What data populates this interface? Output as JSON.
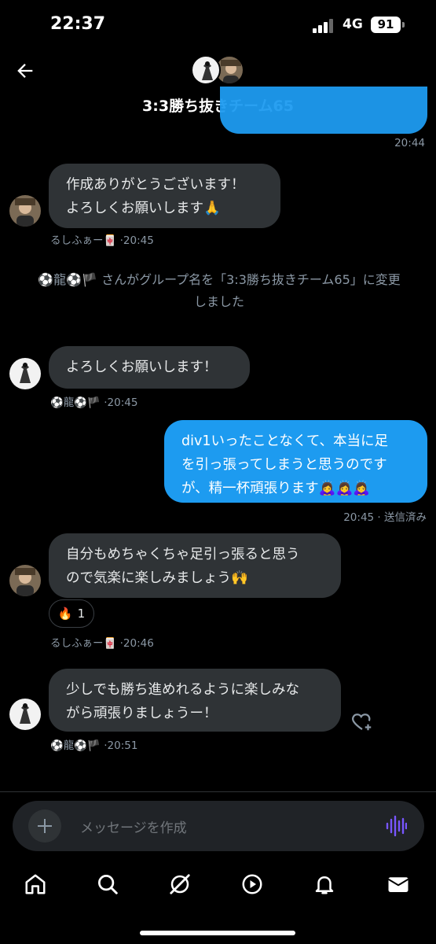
{
  "status": {
    "time": "22:37",
    "network": "4G",
    "battery": "91"
  },
  "header": {
    "title": "3:3勝ち抜きチーム65"
  },
  "messages": [
    {
      "time": "20:44"
    },
    {
      "lines": [
        "作成ありがとうございます！",
        "よろしくお願いします🙏"
      ],
      "sender": "るしふぁー🀄",
      "time": "·20:45"
    },
    {
      "lines": [
        "よろしくお願いします！"
      ],
      "sender": "⚽龍⚽🏴",
      "time": "·20:45"
    },
    {
      "lines": [
        "div1いったことなくて、本当に足",
        "を引っ張ってしまうと思うのです",
        "が、精一杯頑張ります🙇‍♀️🙇‍♀️🙇‍♀️"
      ],
      "time": "20:45 · 送信済み"
    },
    {
      "lines": [
        "自分もめちゃくちゃ足引っ張ると思う",
        "ので気楽に楽しみましょう🙌"
      ],
      "sender": "るしふぁー🀄",
      "time": "·20:46"
    },
    {
      "lines": [
        "少しでも勝ち進めれるように楽しみな",
        "がら頑張りましょうー！"
      ],
      "sender": "⚽龍⚽🏴",
      "time": "·20:51"
    }
  ],
  "system_message": {
    "lines": [
      "⚽龍⚽🏴 さんがグループ名を「3:3勝ち抜きチーム65」に変更",
      "しました"
    ]
  },
  "reaction": {
    "emoji": "🔥",
    "count": "1"
  },
  "composer": {
    "placeholder": "メッセージを作成"
  },
  "tabs": [
    {
      "icon": "home-icon"
    },
    {
      "icon": "search-icon"
    },
    {
      "icon": "grok-icon"
    },
    {
      "icon": "play-icon"
    },
    {
      "icon": "bell-icon"
    },
    {
      "icon": "mail-icon"
    }
  ],
  "colors": {
    "accent": "#1d9bf0",
    "incoming_bubble": "#2f3336",
    "background": "#000000",
    "voice": "#7856ff"
  }
}
